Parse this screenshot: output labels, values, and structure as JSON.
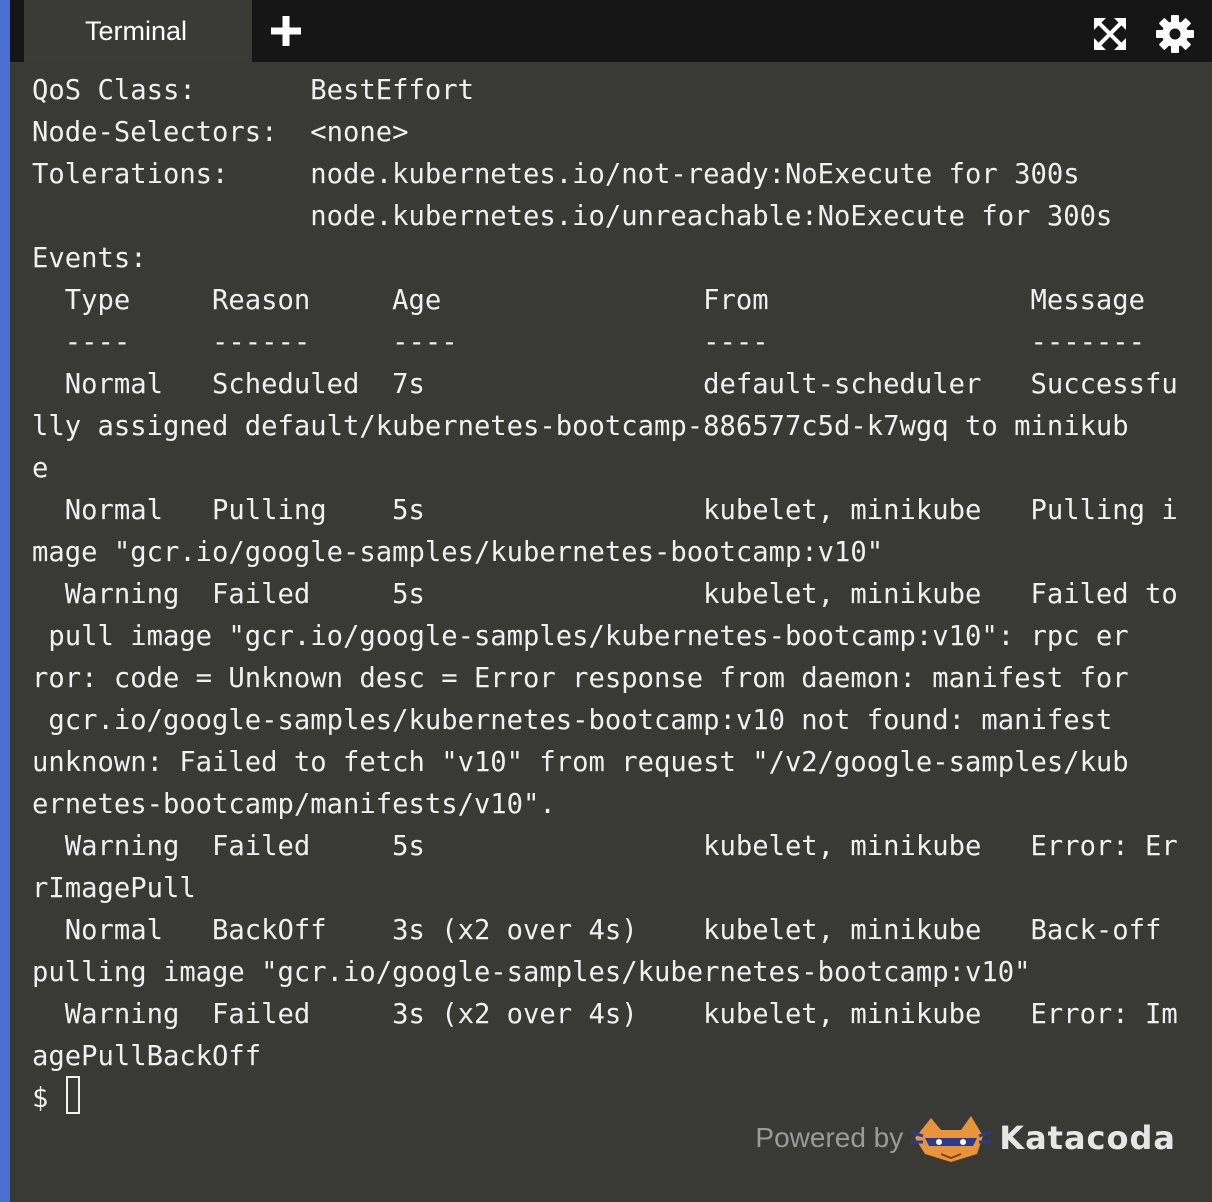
{
  "tabs": {
    "active_label": "Terminal"
  },
  "toolbar": {
    "add_icon": "plus-icon",
    "fullscreen_icon": "fullscreen-icon",
    "settings_icon": "gear-icon"
  },
  "terminal": {
    "output": "QoS Class:       BestEffort\nNode-Selectors:  <none>\nTolerations:     node.kubernetes.io/not-ready:NoExecute for 300s\n                 node.kubernetes.io/unreachable:NoExecute for 300s\nEvents:\n  Type     Reason     Age                From                Message\n  ----     ------     ----               ----                -------\n  Normal   Scheduled  7s                 default-scheduler   Successfu\nlly assigned default/kubernetes-bootcamp-886577c5d-k7wgq to minikub\ne\n  Normal   Pulling    5s                 kubelet, minikube   Pulling i\nmage \"gcr.io/google-samples/kubernetes-bootcamp:v10\"\n  Warning  Failed     5s                 kubelet, minikube   Failed to\n pull image \"gcr.io/google-samples/kubernetes-bootcamp:v10\": rpc er\nror: code = Unknown desc = Error response from daemon: manifest for\n gcr.io/google-samples/kubernetes-bootcamp:v10 not found: manifest\nunknown: Failed to fetch \"v10\" from request \"/v2/google-samples/kub\nernetes-bootcamp/manifests/v10\".\n  Warning  Failed     5s                 kubelet, minikube   Error: Er\nrImagePull\n  Normal   BackOff    3s (x2 over 4s)    kubelet, minikube   Back-off\npulling image \"gcr.io/google-samples/kubernetes-bootcamp:v10\"\n  Warning  Failed     3s (x2 over 4s)    kubelet, minikube   Error: Im\nagePullBackOff",
    "prompt": "$"
  },
  "footer": {
    "powered_by": "Powered by",
    "brand": "Katacoda"
  },
  "colors": {
    "terminal_bg": "#393936",
    "titlebar_bg": "#161616",
    "tab_bg": "#3a3a37",
    "accent_stripe": "#4a6fd1",
    "text": "#f0f0f0"
  }
}
